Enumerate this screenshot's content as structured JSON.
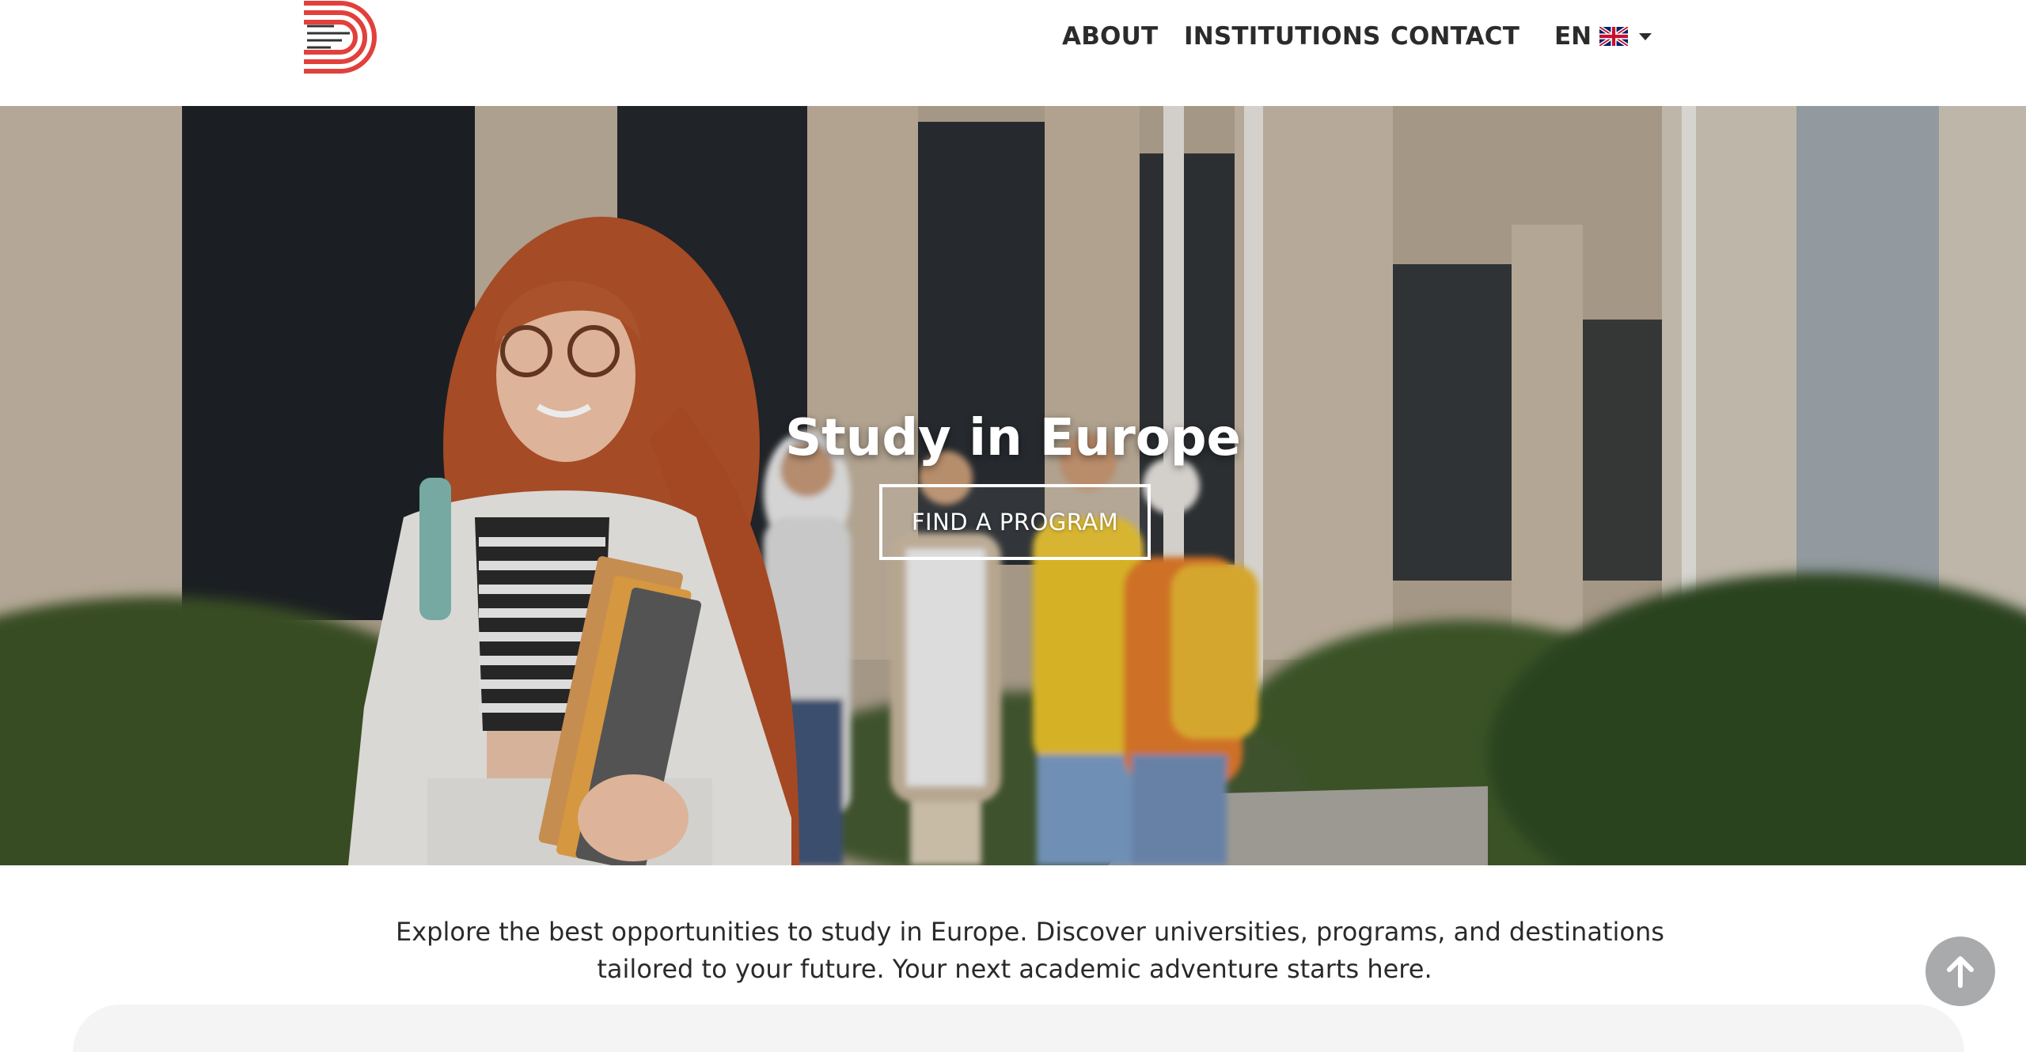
{
  "header": {
    "nav": [
      {
        "label": "ABOUT"
      },
      {
        "label": "INSTITUTIONS"
      },
      {
        "label": "CONTACT"
      }
    ],
    "language": {
      "code": "EN",
      "flag_icon": "uk-flag-icon"
    }
  },
  "hero": {
    "title": "Study in Europe",
    "cta_label": "FIND A PROGRAM"
  },
  "intro": {
    "line1": "Explore the best opportunities to study in Europe. Discover universities, programs, and destinations",
    "line2": "tailored to your future. Your next academic adventure starts here."
  },
  "colors": {
    "brand_red": "#e2403b",
    "nav_text": "#2b2b2b",
    "scroll_button": "#a9aaac"
  }
}
